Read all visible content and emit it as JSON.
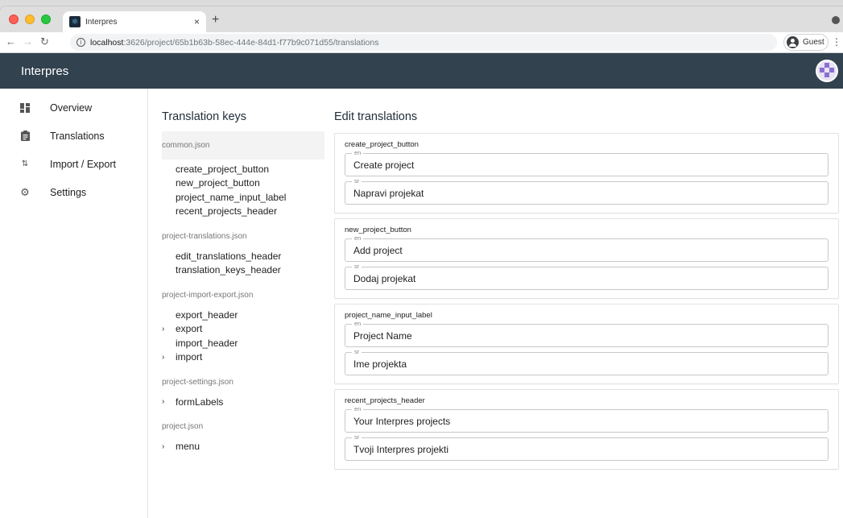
{
  "browser": {
    "tab_title": "Interpres",
    "tab_close": "×",
    "new_tab": "+",
    "url_host": "localhost",
    "url_path": ":3626/project/65b1b63b-58ec-444e-84d1-f77b9c071d55/translations",
    "profile": "Guest"
  },
  "app": {
    "title": "Interpres"
  },
  "sidebar": {
    "items": [
      {
        "label": "Overview",
        "icon": "dashboard-icon"
      },
      {
        "label": "Translations",
        "icon": "clipboard-icon"
      },
      {
        "label": "Import / Export",
        "icon": "import-export-icon"
      },
      {
        "label": "Settings",
        "icon": "gear-icon"
      }
    ]
  },
  "keys_panel": {
    "title": "Translation keys",
    "files": [
      {
        "name": "common.json",
        "keys": [
          "create_project_button",
          "new_project_button",
          "project_name_input_label",
          "recent_projects_header"
        ]
      },
      {
        "name": "project-translations.json",
        "keys": [
          "edit_translations_header",
          "translation_keys_header"
        ]
      },
      {
        "name": "project-import-export.json",
        "keys": [
          "export_header",
          "export",
          "import_header",
          "import"
        ]
      },
      {
        "name": "project-settings.json",
        "keys": [
          "formLabels"
        ]
      },
      {
        "name": "project.json",
        "keys": [
          "menu"
        ]
      }
    ]
  },
  "editor": {
    "title": "Edit translations",
    "cards": [
      {
        "key": "create_project_button",
        "en_label": "en",
        "en": "Create project",
        "sr_label": "sr",
        "sr": "Napravi projekat"
      },
      {
        "key": "new_project_button",
        "en_label": "en",
        "en": "Add project",
        "sr_label": "sr",
        "sr": "Dodaj projekat"
      },
      {
        "key": "project_name_input_label",
        "en_label": "en",
        "en": "Project Name",
        "sr_label": "sr",
        "sr": "Ime projekta"
      },
      {
        "key": "recent_projects_header",
        "en_label": "en",
        "en": "Your Interpres projects",
        "sr_label": "sr",
        "sr": "Tvoji Interpres projekti"
      }
    ]
  },
  "colors": {
    "appbar": "#32424f",
    "accent": "#8a6fd1"
  }
}
